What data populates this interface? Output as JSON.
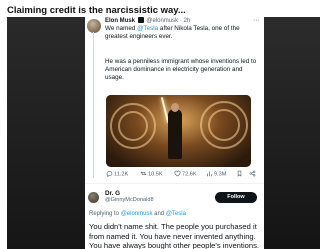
{
  "post": {
    "title": "Claiming credit is the narcissistic way..."
  },
  "tweet": {
    "author_name": "Elon Musk",
    "author_handle": "@elonmusk",
    "time": "· 2h",
    "more_icon": "more-dots-icon",
    "text_before_mention": "We named ",
    "mention": "@Tesla",
    "text_after_mention": " after Nikola Tesla, one of the greatest engineers ever.",
    "text_paragraph_2": "He was a penniless immigrant whose inventions led to American dominance in electricity generation and usage.",
    "image_description_icon": "photo-icon",
    "stats": {
      "replies": "11.2K",
      "retweets": "10.5K",
      "likes": "72.6K",
      "views": "9.3M"
    }
  },
  "reply": {
    "author_name": "Dr. G",
    "author_handle": "@GinnyMcDonald8",
    "follow_label": "Follow",
    "replying_label": "Replying to ",
    "replying_mention_1": "@elonmusk",
    "replying_and": " and ",
    "replying_mention_2": "@Tesla",
    "text": "You didn't name shit. The people you purchased it from named it. You have never invented anything. You have always bought other people's inventions."
  },
  "colors": {
    "link": "#1d9bf0",
    "text": "#0f1419",
    "secondary": "#536471",
    "surround": "#1c1c1c"
  }
}
